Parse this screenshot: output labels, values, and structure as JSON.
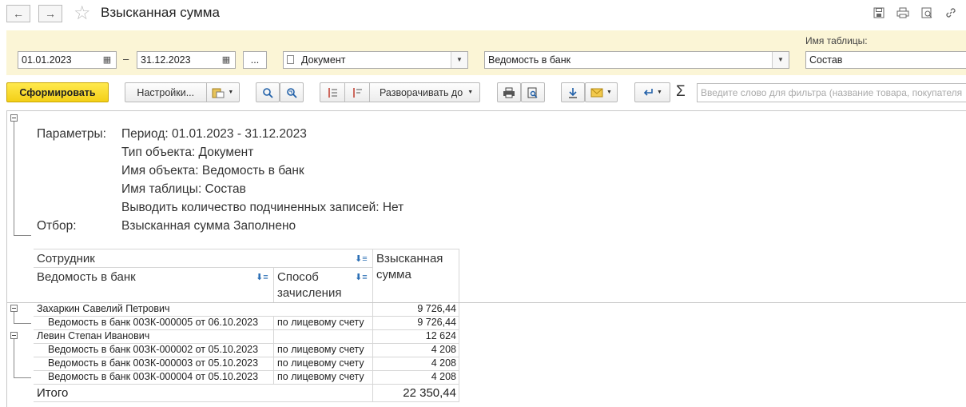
{
  "window": {
    "title": "Взысканная сумма",
    "back_icon": "←",
    "forward_icon": "→",
    "star_icon": "☆"
  },
  "params": {
    "date_from": "01.01.2023",
    "date_dash": "–",
    "date_to": "31.12.2023",
    "ellipsis": "...",
    "object_type": "Документ",
    "object_name": "Ведомость в банк",
    "table_label": "Имя таблицы:",
    "table_name": "Состав"
  },
  "toolbar": {
    "generate": "Сформировать",
    "settings": "Настройки...",
    "expand_to": "Разворачивать до",
    "sigma": "Σ",
    "filter_placeholder": "Введите слово для фильтра (название товара, покупателя"
  },
  "report": {
    "params_label": "Параметры:",
    "filter_label": "Отбор:",
    "lines": [
      "Период: 01.01.2023 - 31.12.2023",
      "Тип объекта: Документ",
      "Имя объекта: Ведомость в банк",
      "Имя таблицы: Состав",
      "Выводить количество подчиненных записей: Нет"
    ],
    "filter_value": "Взысканная сумма Заполнено",
    "headers": {
      "employee": "Сотрудник",
      "statement": "Ведомость в банк",
      "method_1": "Способ",
      "method_2": "зачисления",
      "amount_1": "Взысканная",
      "amount_2": "сумма"
    },
    "rows": [
      {
        "name": "Захаркин Савелий Петрович",
        "method": "",
        "amount": "9 726,44"
      },
      {
        "name": "Ведомость в банк 00ЗК-000005 от 06.10.2023",
        "method": "по лицевому счету",
        "amount": "9 726,44"
      },
      {
        "name": "Левин Степан Иванович",
        "method": "",
        "amount": "12 624"
      },
      {
        "name": "Ведомость в банк 00ЗК-000002 от 05.10.2023",
        "method": "по лицевому счету",
        "amount": "4 208"
      },
      {
        "name": "Ведомость в банк 00ЗК-000003 от 05.10.2023",
        "method": "по лицевому счету",
        "amount": "4 208"
      },
      {
        "name": "Ведомость в банк 00ЗК-000004 от 05.10.2023",
        "method": "по лицевому счету",
        "amount": "4 208"
      }
    ],
    "total_label": "Итого",
    "total_amount": "22 350,44"
  }
}
